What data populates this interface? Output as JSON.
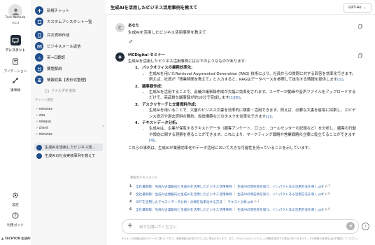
{
  "user": {
    "name": "Taro Yamada",
    "org": "mcd",
    "avatar_glyph": "👤"
  },
  "rail": {
    "items": [
      {
        "label": "アシスタント",
        "icon": "chat-icon",
        "active": true
      },
      {
        "label": "アノテーション",
        "icon": "annotation-icon",
        "active": false
      },
      {
        "label": "議事録",
        "icon": "link-icon",
        "active": false
      },
      {
        "label": "設定",
        "icon": "gear-icon",
        "active": false
      },
      {
        "label": "利用ガイド",
        "icon": "question-icon",
        "active": false
      }
    ],
    "logo_text": "▲ TACHYON 生成AI"
  },
  "sidebar": {
    "new_chat": "新規チャット",
    "custom_assistant": "カスタムアシスタント一覧",
    "assistants": [
      "月次資料作成",
      "ビジネスメール返信",
      "英→日翻訳",
      "要語解説",
      "情報収集【表形式整理】"
    ],
    "folder_create": "フォルダを追加",
    "history_label": "チャット履歴",
    "tree": [
      "minutes",
      "vba",
      "release",
      "client",
      "minutes"
    ],
    "chats": [
      {
        "title": "生成AIを活用したビジネス活…",
        "active": true
      },
      {
        "title": "生成AIの社会実装事例を教えて",
        "active": false
      }
    ]
  },
  "header": {
    "title": "生成AIを活用したビジネス活用事例を教えて",
    "model": "GPT-4o"
  },
  "conversation": {
    "user_avatar": "C",
    "user_name": "あなた",
    "user_message": "生成AIを活用したビジネス活用事例を教えて",
    "assistant_name": "MCDigital セミナー",
    "answer_intro": "生成AIを活用したビジネス活用事例には以下のようなものがあります：",
    "sections": [
      {
        "num": "1.",
        "heading": "バックオフィスの業務効率化:",
        "bullets": [
          "生成AIを用いたRetrieval Augmented Generation (RAG) 技術により、社員からの質問に対する回答を効率化できます。例えば、社員が「残業時間を教えて」と入力すると、RAGはデータベースを参照して該当する情報を提供します",
          "[1]",
          "。"
        ]
      },
      {
        "num": "2.",
        "heading": "議事録作成:",
        "bullets": [
          "生成AIを活用することで、会議の議事録作成が大幅に効率化されます。ユーザーが動画や音声ファイルをアップロードするだけで、高品質な議事録が約10分で完成します",
          "[1][6]",
          "。"
        ]
      },
      {
        "num": "3.",
        "heading": "デスクリサーチと文書資料作成:",
        "bullets": [
          "生成AIを用いることで、大量のビジネス文書を効率的に検索・活用できます。例えば、必要な文書を容易に探索し、エビデンス提示や過去資料の要約、仮説構築などのタスクを効率化できます",
          "[2]",
          "。"
        ]
      },
      {
        "num": "4.",
        "heading": "テキストデータ分析:",
        "bullets": [
          "生成AIは、企業が保有するテキストデータ（顧客アンケート、口コミ、コールセンターの記録など）を分析し、顧客の行動や傾向に関する洞察を得ることができます。これにより、マーケティング戦略や営業戦略の立案に役立てることができます",
          "[4]",
          "。"
        ]
      }
    ],
    "answer_outro": "これらの事例は、生成AIが業務効率化やデータ活用において大きな可能性を持っていることを示しています。",
    "references_label": "参照元ドキュメント",
    "references": [
      {
        "num": "1",
        "title": "全社最新版：生成AI企業動向と生成AIを活用したビジネス活用事例",
        "sep": "|",
        "doc": "生成AIの現在地を知り、インパクトある活用方法を導く.pdf",
        "page": "p.7"
      },
      {
        "num": "2",
        "title": "全社最新版：生成AI企業動向と生成AIを活用したビジネス活用事例",
        "sep": "|",
        "doc": "生成AIの現在地を知り、インパクトある活用方法を導く.pdf",
        "page": "p.6"
      },
      {
        "num": "4",
        "title": "GPTを活用したテキストデータ分析・分類を効率化する方法",
        "sep": "|",
        "doc": "テキスト分析.pdf",
        "page": "p.1"
      },
      {
        "num": "6",
        "title": "全社最新版：生成AI企業動向と生成AIを活用したビジネス活用事例",
        "sep": "|",
        "doc": "生成AIの現在地を知り、インパクトある活用方法を導く.pdf",
        "page": "p.9"
      }
    ]
  },
  "composer": {
    "placeholder": "何でも聞いてください",
    "disclaimer": "タキオンの知識は過去のデータに基づいており、最新情報は反映されていない場合があります。また、タキオンはもっともらしい情報を提供する場合がありますので、その情報の信憑性は必ず確認してください。"
  },
  "colors": {
    "accent": "#1f4e8c",
    "active_rail": "#1f2937",
    "assistant_avatar": "#1f2937"
  }
}
